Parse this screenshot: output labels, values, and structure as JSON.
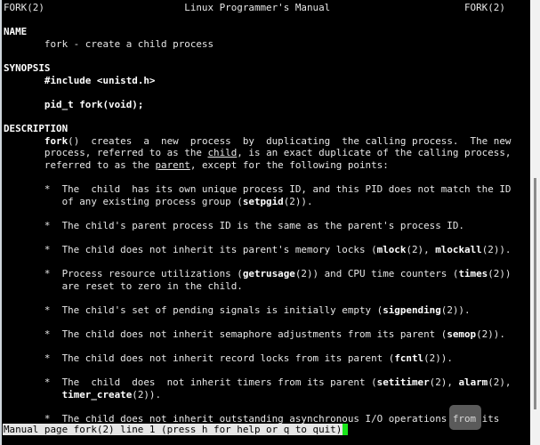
{
  "lines": [
    [
      [
        "FORK(2)                        Linux Programmer's Manual                       FORK(2)",
        ""
      ]
    ],
    [],
    [
      [
        "NAME",
        "b"
      ]
    ],
    [
      [
        "       fork - create a child process",
        ""
      ]
    ],
    [],
    [
      [
        "SYNOPSIS",
        "b"
      ]
    ],
    [
      [
        "       ",
        ""
      ],
      [
        "#include <unistd.h>",
        "b"
      ]
    ],
    [],
    [
      [
        "       ",
        ""
      ],
      [
        "pid_t fork(void);",
        "b"
      ]
    ],
    [],
    [
      [
        "DESCRIPTION",
        "b"
      ]
    ],
    [
      [
        "       ",
        ""
      ],
      [
        "fork",
        "b"
      ],
      [
        "()  creates  a  new  process  by  duplicating  the calling process.  The new",
        ""
      ]
    ],
    [
      [
        "       process, referred to as the ",
        ""
      ],
      [
        "child",
        "u"
      ],
      [
        ", is an exact duplicate of the calling process,",
        ""
      ]
    ],
    [
      [
        "       referred to as the ",
        ""
      ],
      [
        "parent",
        "u"
      ],
      [
        ", except for the following points:",
        ""
      ]
    ],
    [],
    [
      [
        "       *  The  child  has its own unique process ID, and this PID does not match the ID",
        ""
      ]
    ],
    [
      [
        "          of any existing process group (",
        ""
      ],
      [
        "setpgid",
        "b"
      ],
      [
        "(2)).",
        ""
      ]
    ],
    [],
    [
      [
        "       *  The child's parent process ID is the same as the parent's process ID.",
        ""
      ]
    ],
    [],
    [
      [
        "       *  The child does not inherit its parent's memory locks (",
        ""
      ],
      [
        "mlock",
        "b"
      ],
      [
        "(2), ",
        ""
      ],
      [
        "mlockall",
        "b"
      ],
      [
        "(2)).",
        ""
      ]
    ],
    [],
    [
      [
        "       *  Process resource utilizations (",
        ""
      ],
      [
        "getrusage",
        "b"
      ],
      [
        "(2)) and CPU time counters (",
        ""
      ],
      [
        "times",
        "b"
      ],
      [
        "(2))",
        ""
      ]
    ],
    [
      [
        "          are reset to zero in the child.",
        ""
      ]
    ],
    [],
    [
      [
        "       *  The child's set of pending signals is initially empty (",
        ""
      ],
      [
        "sigpending",
        "b"
      ],
      [
        "(2)).",
        ""
      ]
    ],
    [],
    [
      [
        "       *  The child does not inherit semaphore adjustments from its parent (",
        ""
      ],
      [
        "semop",
        "b"
      ],
      [
        "(2)).",
        ""
      ]
    ],
    [],
    [
      [
        "       *  The child does not inherit record locks from its parent (",
        ""
      ],
      [
        "fcntl",
        "b"
      ],
      [
        "(2)).",
        ""
      ]
    ],
    [],
    [
      [
        "       *  The  child  does  not inherit timers from its parent (",
        ""
      ],
      [
        "setitimer",
        "b"
      ],
      [
        "(2), ",
        ""
      ],
      [
        "alarm",
        "b"
      ],
      [
        "(2),",
        ""
      ]
    ],
    [
      [
        "          ",
        ""
      ],
      [
        "timer_create",
        "b"
      ],
      [
        "(2)).",
        ""
      ]
    ],
    [],
    [
      [
        "       *  The child does not inherit outstanding asynchronous I/O operations from its",
        ""
      ]
    ]
  ],
  "status": "Manual page fork(2) line 1 (press h for help or q to quit)",
  "colors": {
    "background": "#000000",
    "text": "#e6e6e6",
    "cursor": "#19e619",
    "status_bg": "#e6e6e6"
  }
}
